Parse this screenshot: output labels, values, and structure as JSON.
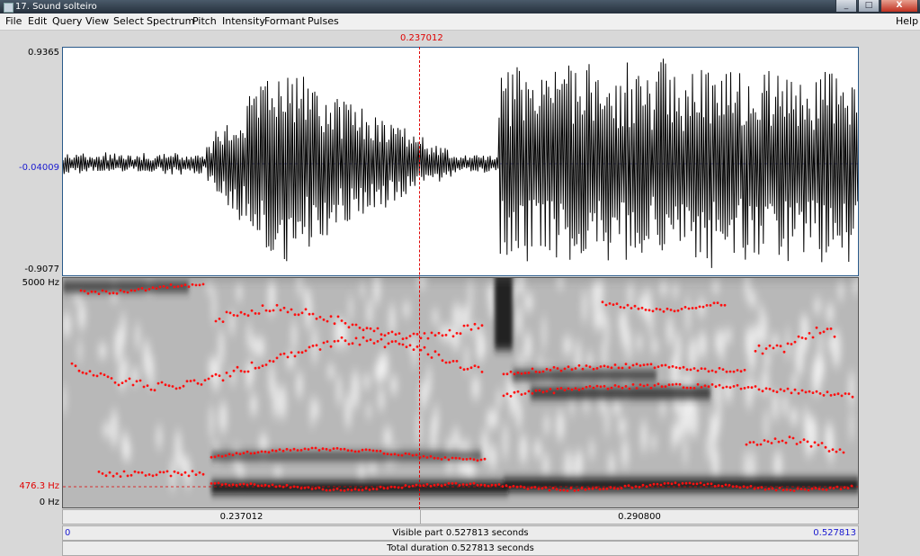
{
  "window": {
    "title": "17. Sound solteiro",
    "min": "_",
    "max": "□",
    "close": "X"
  },
  "menu": {
    "file": "File",
    "edit": "Edit",
    "query": "Query",
    "view": "View",
    "select": "Select",
    "spectrum": "Spectrum",
    "pitch": "Pitch",
    "intensity": "Intensity",
    "formant": "Formant",
    "pulses": "Pulses",
    "help": "Help"
  },
  "cursor": {
    "time_label": "0.237012",
    "fraction": 0.449
  },
  "waveform": {
    "max_label": "0.9365",
    "center_label": "-0.04009",
    "min_label": "-0.9077"
  },
  "spectrogram": {
    "top_label": "5000 Hz",
    "cursor_freq_label": "476.3 Hz",
    "bottom_label": "0 Hz"
  },
  "time_axis": {
    "left_segment_label": "0.237012",
    "right_segment_label": "0.290800",
    "start": "0",
    "end": "0.527813",
    "visible_part": "Visible part 0.527813 seconds",
    "total_duration": "Total duration 0.527813 seconds"
  },
  "colors": {
    "cursor": "#e00000",
    "formant": "#ff1010",
    "wave": "#000000",
    "frame": "#2a5a8a"
  }
}
